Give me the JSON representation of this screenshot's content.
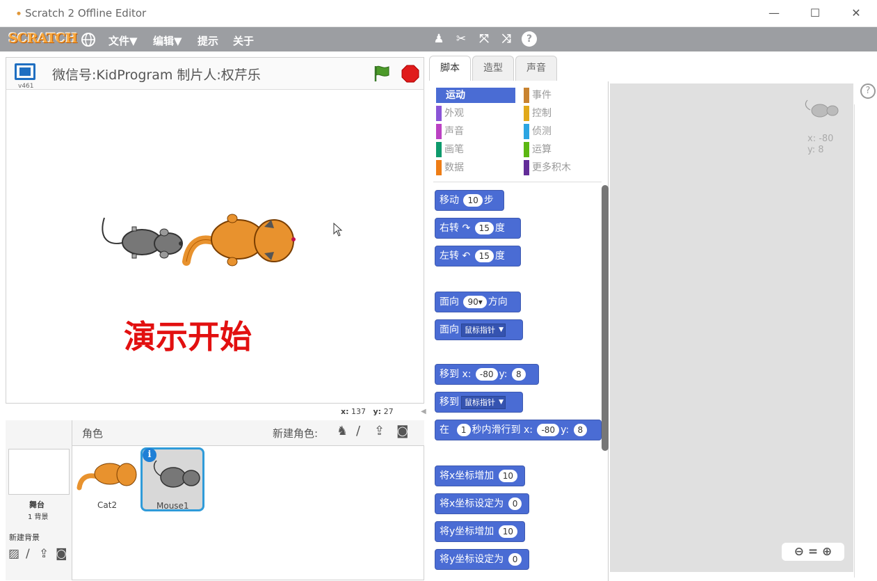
{
  "window": {
    "title": "Scratch 2 Offline Editor",
    "minimize": "—",
    "maximize": "☐",
    "close": "✕"
  },
  "menubar": {
    "logo": "SCRATCH",
    "file": "文件▼",
    "edit": "编辑▼",
    "tips": "提示",
    "about": "关于"
  },
  "stage": {
    "title": "微信号:KidProgram 制片人:权芹乐",
    "version": "v461",
    "overlay_text": "演示开始",
    "x_label": "x:",
    "x_value": "137",
    "y_label": "y:",
    "y_value": "27"
  },
  "sprites_pane": {
    "header": "角色",
    "new_sprite": "新建角色:",
    "stage_label": "舞台",
    "backdrops": "1 背景",
    "new_backdrop": "新建背景",
    "sprites": [
      "Cat2",
      "Mouse1"
    ]
  },
  "tabs": [
    "脚本",
    "造型",
    "声音"
  ],
  "categories": {
    "left": [
      "运动",
      "外观",
      "声音",
      "画笔",
      "数据"
    ],
    "right": [
      "事件",
      "控制",
      "侦测",
      "运算",
      "更多积木"
    ]
  },
  "blocks": {
    "move": {
      "pre": "移动",
      "val": "10",
      "post": "步"
    },
    "turn_right": {
      "pre": "右转",
      "icon": "↷",
      "val": "15",
      "post": "度"
    },
    "turn_left": {
      "pre": "左转",
      "icon": "↶",
      "val": "15",
      "post": "度"
    },
    "point_dir": {
      "pre": "面向",
      "val": "90▾",
      "post": "方向"
    },
    "point_towards": {
      "pre": "面向",
      "dd": "鼠标指针"
    },
    "goto_xy": {
      "pre": "移到 x:",
      "x": "-80",
      "mid": "y:",
      "y": "8"
    },
    "goto": {
      "pre": "移到",
      "dd": "鼠标指针"
    },
    "glide": {
      "pre": "在",
      "val": "1",
      "mid": "秒内滑行到 x:",
      "x": "-80",
      "mid2": "y:",
      "y": "8"
    },
    "change_x": {
      "pre": "将x坐标增加",
      "val": "10"
    },
    "set_x": {
      "pre": "将x坐标设定为",
      "val": "0"
    },
    "change_y": {
      "pre": "将y坐标增加",
      "val": "10"
    },
    "set_y": {
      "pre": "将y坐标设定为",
      "val": "0"
    }
  },
  "scripts_area": {
    "x_label": "x: -80",
    "y_label": "y: 8"
  },
  "colors": {
    "motion": "#4a6cd4",
    "looks": "#8a55d7",
    "sound": "#bb42c3",
    "pen": "#0e9a6c",
    "data": "#ee7d16",
    "events": "#c88330",
    "control": "#e1a91a",
    "sensing": "#2ca5e2",
    "operators": "#5cb712",
    "more": "#632d99"
  }
}
